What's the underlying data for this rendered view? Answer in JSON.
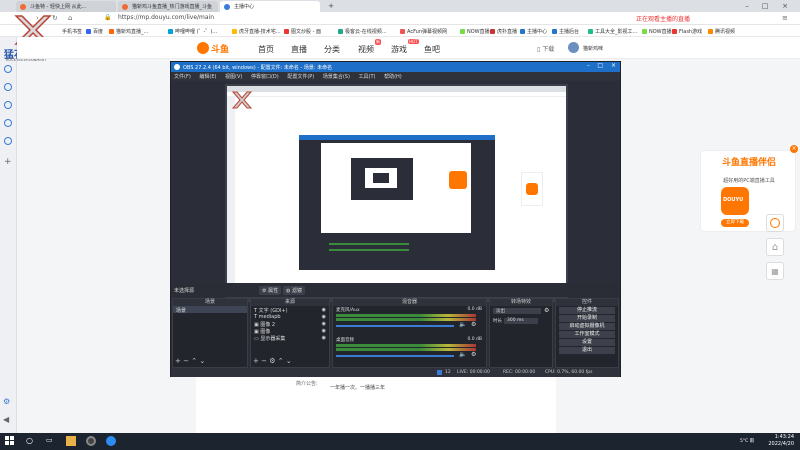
{
  "browser": {
    "tabs": [
      {
        "label": "斗鱼特 - 轻快上网 从此..."
      },
      {
        "label": "猫斩鸡斗鱼直播_热门游戏直播_斗鱼"
      },
      {
        "label": "主播中心"
      }
    ],
    "url": "https://mp.douyu.com/live/main",
    "bookmarks": [
      "手机书签",
      "百度",
      "猫斩鸡直播_...",
      "哔哩哔哩 (゜-゜)...",
      "虎牙直播-技术宅...",
      "图文炒股 - 面",
      "极客云-在线视频...",
      "AcFun弹幕视频网",
      "NOW直播",
      "虎扑直播",
      "主播中心",
      "主播后台",
      "工具大全_影视工...",
      "NOW直播",
      "Flash游戏",
      "腾讯视频"
    ],
    "top_right_text": "正在观看主播的直播"
  },
  "douyu": {
    "logo_text": "斗鱼",
    "nav": [
      "首页",
      "直播",
      "分类",
      "视频",
      "游戏",
      "鱼吧"
    ],
    "badge_video": "新",
    "badge_game": "HOT",
    "download_label": "下载",
    "username": "猫斩鸡咪"
  },
  "watermark": {
    "main": "猛石互娱",
    "sub": "ROCK ENTERTAINMENT"
  },
  "obs": {
    "title": "OBS 27.2.4 (64 bit, windows) - 配置文件: 未命名 - 场景: 未命名",
    "menu": [
      "文件(F)",
      "编辑(E)",
      "视图(V)",
      "停靠窗口(D)",
      "配置文件(P)",
      "场景集合(S)",
      "工具(T)",
      "帮助(H)"
    ],
    "scene_bar_label": "未选择源",
    "scene_bar_btn1": "属性",
    "scene_bar_btn2": "滤镜",
    "docks": {
      "scenes": "场景",
      "sources": "来源",
      "mixer": "混音器",
      "transitions": "转场特效",
      "controls": "控件"
    },
    "scenes": [
      "场景"
    ],
    "sources": [
      "文字 (GDI+)",
      "mediapb",
      "图像 2",
      "图像",
      "显示器采集"
    ],
    "mixer": [
      {
        "name": "麦克风/Aux",
        "db": "0.0 dB"
      },
      {
        "name": "桌面音频",
        "db": "0.0 dB"
      }
    ],
    "transition": {
      "type": "淡出",
      "duration_label": "时长",
      "duration": "300 ms"
    },
    "controls": [
      "停止推流",
      "开始录制",
      "启动虚拟摄像机",
      "工作室模式",
      "设置",
      "退出"
    ],
    "status": {
      "live": "LIVE: 00:00:00",
      "rec": "REC: 00:00:00",
      "cpu": "CPU: 0.7%, 60.00 fps",
      "dropped": "12"
    }
  },
  "page": {
    "label": "简介公告:",
    "text": "一年播一次、一播播三年"
  },
  "ad": {
    "title": "斗鱼直播伴侣",
    "subtitle": "超好用的PC端直播工具",
    "button": "立即下载",
    "icon_text": "DOUYU"
  },
  "taskbar": {
    "weather": "5°C 雨",
    "time": "1:43:24",
    "date": "2022/4/20"
  },
  "colors": {
    "douyu_orange": "#ff7700",
    "obs_title_blue": "#1e6fc8",
    "taskbar": "#1c2430"
  }
}
